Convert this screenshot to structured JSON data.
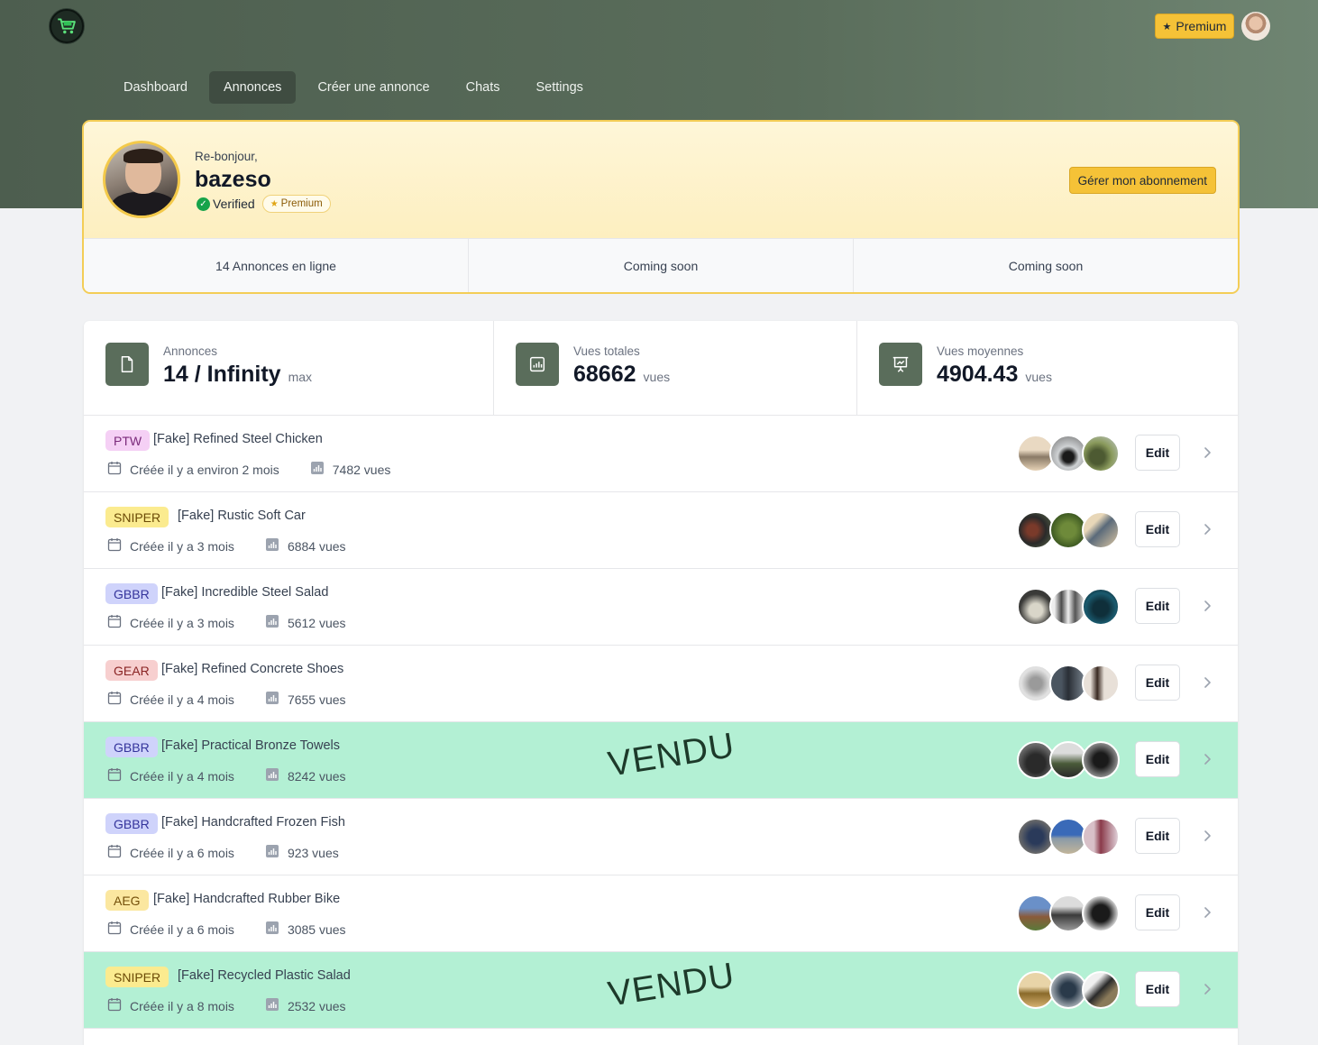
{
  "app": {
    "logo_icon": "cart-logo-icon"
  },
  "header": {
    "premium_label": "Premium",
    "nav": [
      {
        "label": "Dashboard",
        "active": false
      },
      {
        "label": "Annonces",
        "active": true
      },
      {
        "label": "Créer une annonce",
        "active": false
      },
      {
        "label": "Chats",
        "active": false
      },
      {
        "label": "Settings",
        "active": false
      }
    ]
  },
  "profile": {
    "greeting": "Re-bonjour,",
    "username": "bazeso",
    "verified_label": "Verified",
    "premium_badge": "Premium",
    "manage_button": "Gérer mon abonnement",
    "stats": [
      "14 Annonces en ligne",
      "Coming soon",
      "Coming soon"
    ]
  },
  "stats": [
    {
      "label": "Annonces",
      "value": "14 / Infinity",
      "unit": "max",
      "icon": "document-icon"
    },
    {
      "label": "Vues totales",
      "value": "68662",
      "unit": "vues",
      "icon": "chart-icon"
    },
    {
      "label": "Vues moyennes",
      "value": "4904.43",
      "unit": "vues",
      "icon": "presentation-chart-icon"
    }
  ],
  "listings": [
    {
      "tag": "PTW",
      "title": "[Fake] Refined Steel Chicken",
      "created": "Créée il y a environ 2 mois",
      "views": "7482 vues",
      "sold": false,
      "edit": "Edit"
    },
    {
      "tag": "SNIPER",
      "title": "[Fake] Rustic Soft Car",
      "created": "Créée il y a 3 mois",
      "views": "6884 vues",
      "sold": false,
      "edit": "Edit"
    },
    {
      "tag": "GBBR",
      "title": "[Fake] Incredible Steel Salad",
      "created": "Créée il y a 3 mois",
      "views": "5612 vues",
      "sold": false,
      "edit": "Edit"
    },
    {
      "tag": "GEAR",
      "title": "[Fake] Refined Concrete Shoes",
      "created": "Créée il y a 4 mois",
      "views": "7655 vues",
      "sold": false,
      "edit": "Edit"
    },
    {
      "tag": "GBBR",
      "title": "[Fake] Practical Bronze Towels",
      "created": "Créée il y a 4 mois",
      "views": "8242 vues",
      "sold": true,
      "sold_label": "VENDU",
      "edit": "Edit"
    },
    {
      "tag": "GBBR",
      "title": "[Fake] Handcrafted Frozen Fish",
      "created": "Créée il y a 6 mois",
      "views": "923 vues",
      "sold": false,
      "edit": "Edit"
    },
    {
      "tag": "AEG",
      "title": "[Fake] Handcrafted Rubber Bike",
      "created": "Créée il y a 6 mois",
      "views": "3085 vues",
      "sold": false,
      "edit": "Edit"
    },
    {
      "tag": "SNIPER",
      "title": "[Fake] Recycled Plastic Salad",
      "created": "Créée il y a 8 mois",
      "views": "2532 vues",
      "sold": true,
      "sold_label": "VENDU",
      "edit": "Edit"
    }
  ],
  "colors": {
    "brand": "#5a6d5b",
    "accent": "#f5c237",
    "sold_bg": "#b3f0d4",
    "tags": {
      "PTW": {
        "bg": "#f5d0f5",
        "fg": "#7a2a7a"
      },
      "SNIPER": {
        "bg": "#fbeb8f",
        "fg": "#6b4a06"
      },
      "GBBR": {
        "bg": "#cfd3fb",
        "fg": "#34349b"
      },
      "GEAR": {
        "bg": "#f7cfcf",
        "fg": "#8a2424"
      },
      "AEG": {
        "bg": "#fbe7a0",
        "fg": "#74500a"
      }
    }
  }
}
